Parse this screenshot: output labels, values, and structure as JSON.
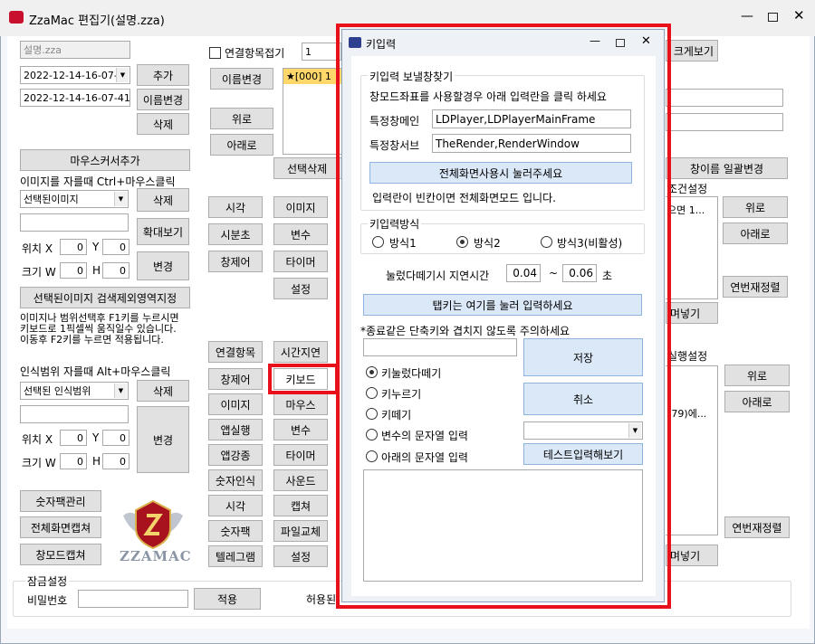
{
  "main": {
    "title": "ZzaMac 편집기(설명.zza)",
    "file_name": "설명.zza",
    "date1": "2022-12-14-16-07-",
    "date2": "2022-12-14-16-07-41",
    "btn_add": "추가",
    "btn_rename": "이름변경",
    "btn_delete": "삭제",
    "btn_mouse_add": "마우스커서추가",
    "crop_hint": "이미지를 자를때 Ctrl+마우스클릭",
    "sel_image": "선택된이미지",
    "btn_delete2": "삭제",
    "btn_zoom": "확대보기",
    "pos_label": "위치 X",
    "pos_x": "0",
    "pos_y_label": "Y",
    "pos_y": "0",
    "size_label": "크기 W",
    "size_w": "0",
    "size_h_label": "H",
    "size_h": "0",
    "btn_change": "변경",
    "btn_search_area": "선택된이미지 검색제외영역지정",
    "hint_lines": [
      "이미지나 범위선택후 F1키를 누르시면",
      "키보드로 1픽셀씩 움직일수 있습니다.",
      "이동후 F2키를 누르면 적용됩니다."
    ],
    "range_hint": "인식범위 자를때 Alt+마우스클릭",
    "sel_range": "선택된 인식범위",
    "btn_delete3": "삭제",
    "pos_label2": "위치 X",
    "pos_x2": "0",
    "pos_y_label2": "Y",
    "pos_y2": "0",
    "size_label2": "크기 W",
    "size_w2": "0",
    "size_h_label2": "H",
    "size_h2": "0",
    "btn_change2": "변경",
    "btn_numpad": "숫자팩관리",
    "btn_fullcap": "전체화면캡쳐",
    "btn_wincap": "창모드캡쳐",
    "logo_text": "ZZAMAC",
    "connect_chk": "연결항목접기",
    "connect_val": "1",
    "btn_rename2": "이름변경",
    "btn_up": "위로",
    "btn_down": "아래로",
    "list_item": "★[000] 1",
    "btn_selected_del": "선택삭제",
    "cmd_grid1": [
      "시각",
      "이미지",
      "시분초",
      "변수",
      "창제어",
      "타이머",
      "",
      "설정"
    ],
    "btn_connect": "연결항목",
    "btn_delay": "시간지연",
    "cmd_grid2": [
      "창제어",
      "키보드",
      "이미지",
      "마우스",
      "앱실행",
      "변수",
      "앱강종",
      "타이머",
      "숫자인식",
      "사운드",
      "시각",
      "캡쳐",
      "숫자팩",
      "파일교체",
      "텔레그램",
      "설정"
    ],
    "right_btn_view": "크게보기",
    "right_btn_rename_all": "창이름 일괄변경",
    "cond_label": "조건설정",
    "cond_item": "으면 1...",
    "btn_r_up": "위로",
    "btn_r_down": "아래로",
    "btn_renumber": "연번재정렬",
    "btn_insert": "며넣기",
    "exec_label": "실행설정",
    "exec_item": "!79)에...",
    "btn_r_up2": "위로",
    "btn_r_down2": "아래로",
    "btn_renumber2": "연번재정렬",
    "btn_insert2": "며넣기",
    "lock_title": "잠금설정",
    "pw_label": "비밀번호",
    "btn_apply": "적용",
    "allow_text": "허용된"
  },
  "dialog": {
    "title": "키입력",
    "grp_window": "키입력 보낼창찾기",
    "window_hint": "창모드좌표를 사용할경우 아래 입력란을 클릭 하세요",
    "main_label": "특정창메인",
    "main_value": "LDPlayer,LDPlayerMainFrame",
    "sub_label": "특정창서브",
    "sub_value": "TheRender,RenderWindow",
    "btn_fullscreen": "전체화면사용시 눌러주세요",
    "blank_hint": "입력란이 빈칸이면 전체화면모드 입니다.",
    "grp_method": "키입력방식",
    "method1": "방식1",
    "method2": "방식2",
    "method3": "방식3(비활성)",
    "delay_label": "눌렀다떼기시 지연시간",
    "delay_min": "0.04",
    "delay_sep": "~",
    "delay_max": "0.06",
    "delay_unit": "초",
    "btn_tabkey": "탭키는 여기를 눌러 입력하세요",
    "warning": "*종료같은 단축키와 겹치지 않도록 주의하세요",
    "btn_save": "저장",
    "btn_cancel": "취소",
    "opt1": "키눌렀다떼기",
    "opt2": "키누르기",
    "opt3": "키떼기",
    "opt4": "변수의 문자열 입력",
    "opt5": "아래의 문자열 입력",
    "btn_test": "테스트입력해보기",
    "selected_option": "키눌렀다떼기",
    "selected_method": "방식2"
  },
  "colors": {
    "highlight": "#e8101a",
    "accent_btn": "#dbe8f8"
  }
}
